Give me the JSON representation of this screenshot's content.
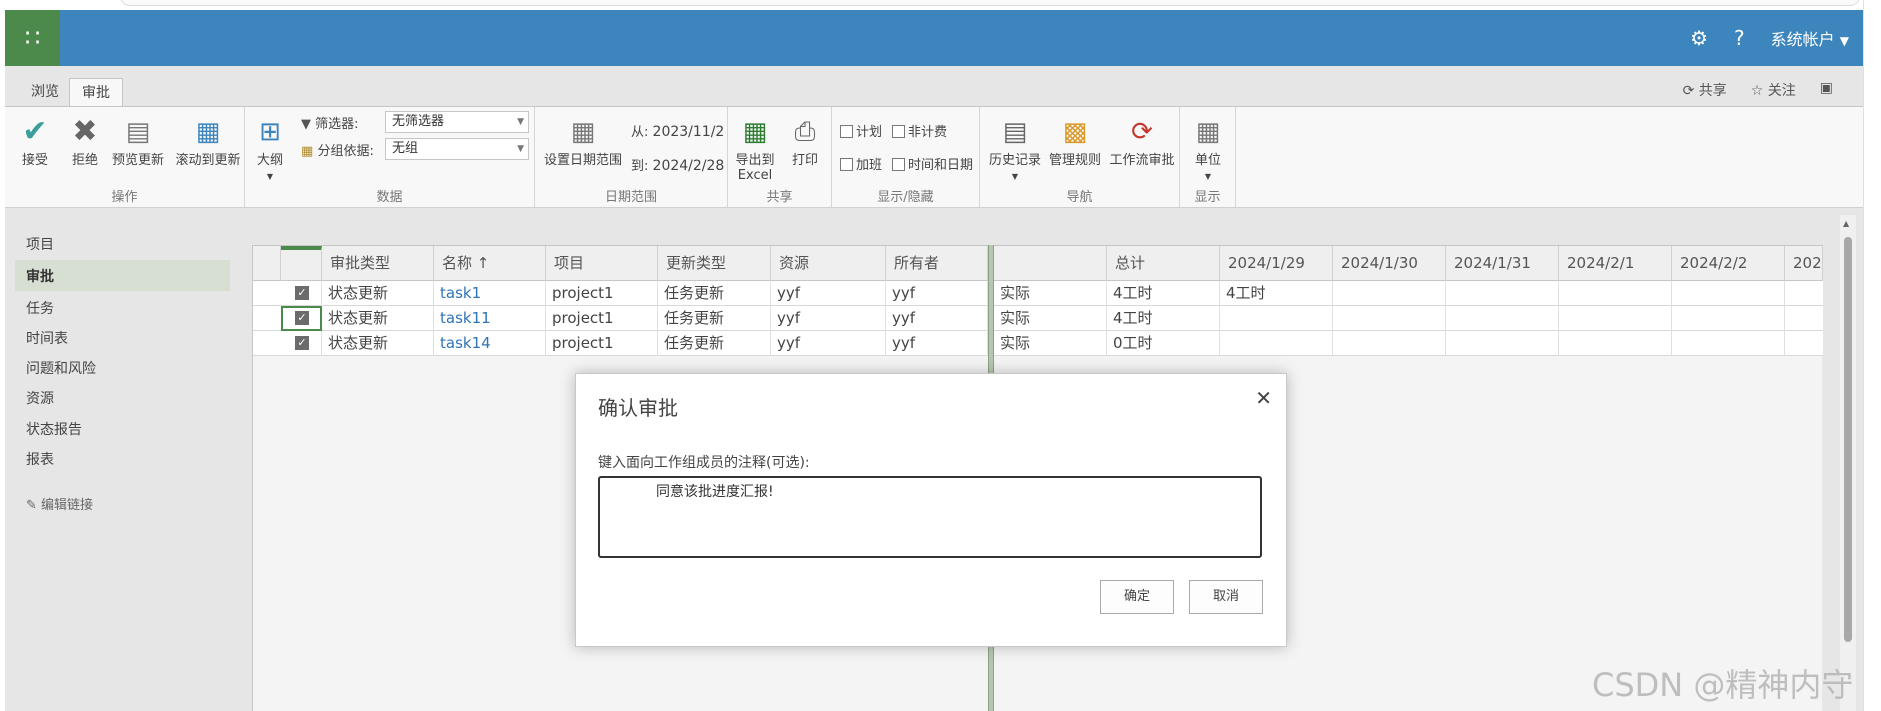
{
  "suitebar": {
    "account": "系统帐户",
    "help": "?"
  },
  "ribbon_tabs": [
    "浏览",
    "审批"
  ],
  "ribbon_right": {
    "share": "共享",
    "follow": "关注"
  },
  "ribbon": {
    "actions": {
      "accept": "接受",
      "reject": "拒绝",
      "preview": "预览更新",
      "scroll": "滚动到更新",
      "group": "操作"
    },
    "data": {
      "outline": "大纲",
      "filter_label": "筛选器:",
      "filter_value": "无筛选器",
      "groupby_label": "分组依据:",
      "groupby_value": "无组",
      "group": "数据"
    },
    "date": {
      "set_range": "设置日期范围",
      "from_label": "从:",
      "from": "2023/11/2",
      "to_label": "到:",
      "to": "2024/2/28",
      "group": "日期范围"
    },
    "share": {
      "export": "导出到",
      "export2": "Excel",
      "print": "打印",
      "group": "共享"
    },
    "showhide": {
      "plan": "计划",
      "nonbill": "非计费",
      "overtime": "加班",
      "timedate": "时间和日期",
      "group": "显示/隐藏"
    },
    "nav": {
      "history": "历史记录",
      "rules": "管理规则",
      "workflow": "工作流审批",
      "group": "导航"
    },
    "display": {
      "units": "单位",
      "group": "显示"
    }
  },
  "leftnav": {
    "items": [
      "项目",
      "审批",
      "任务",
      "时间表",
      "问题和风险",
      "资源",
      "状态报告",
      "报表"
    ],
    "edit_links": "编辑链接"
  },
  "grid": {
    "headers": [
      "审批类型",
      "名称",
      "项目",
      "更新类型",
      "资源",
      "所有者"
    ],
    "right_headers": [
      "",
      "总计",
      "2024/1/29",
      "2024/1/30",
      "2024/1/31",
      "2024/2/1",
      "2024/2/2",
      "202"
    ],
    "rows": [
      {
        "type": "状态更新",
        "name": "task1",
        "project": "project1",
        "update": "任务更新",
        "resource": "yyf",
        "owner": "yyf",
        "kind": "实际",
        "total": "4工时",
        "d1": "4工时"
      },
      {
        "type": "状态更新",
        "name": "task11",
        "project": "project1",
        "update": "任务更新",
        "resource": "yyf",
        "owner": "yyf",
        "kind": "实际",
        "total": "4工时",
        "d1": ""
      },
      {
        "type": "状态更新",
        "name": "task14",
        "project": "project1",
        "update": "任务更新",
        "resource": "yyf",
        "owner": "yyf",
        "kind": "实际",
        "total": "0工时",
        "d1": ""
      }
    ]
  },
  "dialog": {
    "title": "确认审批",
    "label": "键入面向工作组成员的注释(可选):",
    "comment": "同意该批进度汇报!",
    "ok": "确定",
    "cancel": "取消"
  },
  "watermark": "CSDN @精神内守"
}
